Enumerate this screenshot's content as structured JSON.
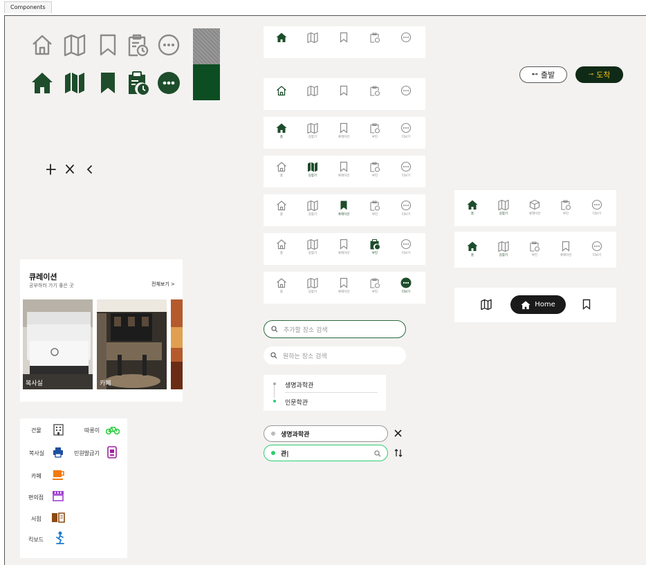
{
  "page_tab": "Components",
  "route": {
    "depart": "출발",
    "arrive": "도착"
  },
  "nav_labels": [
    "홈",
    "길찾기",
    "큐레이션",
    "루틴",
    "더보기"
  ],
  "nav_variant_rows": [
    {
      "labels": [
        "홈",
        "길찾기",
        "큐레이션",
        "루틴",
        "더보기"
      ]
    },
    {
      "labels": [
        "홈",
        "길찾기",
        "큐레이션",
        "루틴",
        "더보기"
      ]
    }
  ],
  "home_pill": {
    "label": "Home"
  },
  "curation": {
    "title": "큐레이션",
    "subtitle": "공부하러 가기 좋은 곳",
    "view_all": "전체보기 >",
    "cards": [
      {
        "label": "복사실"
      },
      {
        "label": "카페"
      }
    ]
  },
  "search": {
    "placeholder_1": "추가할 장소 검색",
    "placeholder_2": "원하는 장소 검색"
  },
  "route_list": {
    "start": "생명과학관",
    "end": "인문학관"
  },
  "route_inputs": {
    "from": "생명과학관",
    "to": "관|"
  },
  "categories": [
    {
      "label": "건물",
      "icon": "building-icon"
    },
    {
      "label": "따릉이",
      "icon": "bicycle-icon"
    },
    {
      "label": "복사실",
      "icon": "printer-icon"
    },
    {
      "label": "민원발급기",
      "icon": "kiosk-icon"
    },
    {
      "label": "카페",
      "icon": "coffee-icon"
    },
    {
      "label": "편의점",
      "icon": "store-icon"
    },
    {
      "label": "서점",
      "icon": "book-icon"
    },
    {
      "label": "킥보드",
      "icon": "scooter-icon"
    }
  ],
  "colors": {
    "primary": "#1e4d2b",
    "accent": "#2ecc71",
    "inactive": "#8a8a8a",
    "arrive_text": "#f5c518"
  }
}
